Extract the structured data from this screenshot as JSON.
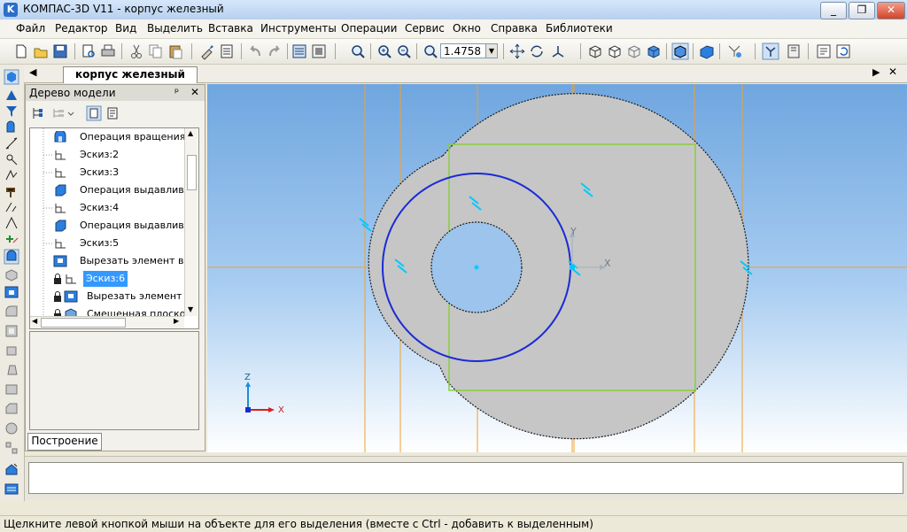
{
  "window": {
    "title": "КОМПАС-3D V11 - корпус железный"
  },
  "menu": {
    "items": [
      "Файл",
      "Редактор",
      "Вид",
      "Выделить",
      "Вставка",
      "Инструменты",
      "Операции",
      "Сервис",
      "Окно",
      "Справка",
      "Библиотеки"
    ]
  },
  "toolbar": {
    "zoom_value": "1.4758"
  },
  "document": {
    "tab_label": "корпус железный"
  },
  "tree": {
    "title": "Дерево модели",
    "bottom_tab": "Построение",
    "items": [
      {
        "label": "Операция вращения:",
        "icon": "rotation-op-icon"
      },
      {
        "label": "Эскиз:2",
        "icon": "sketch-icon"
      },
      {
        "label": "Эскиз:3",
        "icon": "sketch-icon"
      },
      {
        "label": "Операция выдавлива",
        "icon": "extrusion-icon"
      },
      {
        "label": "Эскиз:4",
        "icon": "sketch-icon"
      },
      {
        "label": "Операция выдавлива",
        "icon": "extrusion-icon"
      },
      {
        "label": "Эскиз:5",
        "icon": "sketch-icon"
      },
      {
        "label": "Вырезать элемент вы",
        "icon": "cut-icon"
      },
      {
        "label": "Эскиз:6",
        "icon": "sketch-icon",
        "selected": true,
        "locked": true
      },
      {
        "label": "Вырезать элемент в",
        "icon": "cut-icon",
        "locked": true
      },
      {
        "label": "Смещенная плоско",
        "icon": "plane-icon",
        "locked": true
      }
    ]
  },
  "viewport": {
    "axis_labels": {
      "x": "X",
      "y": "Y",
      "z": "Z",
      "triad_x": "X"
    }
  },
  "status": {
    "text": "Щелкните левой кнопкой мыши на объекте для его выделения (вместе с Ctrl - добавить к выделенным)"
  },
  "colors": {
    "selection": "#3399ff",
    "sketch": "#1a2bd6",
    "part_fill": "#c6c6c6",
    "construction": "#f0a030"
  }
}
